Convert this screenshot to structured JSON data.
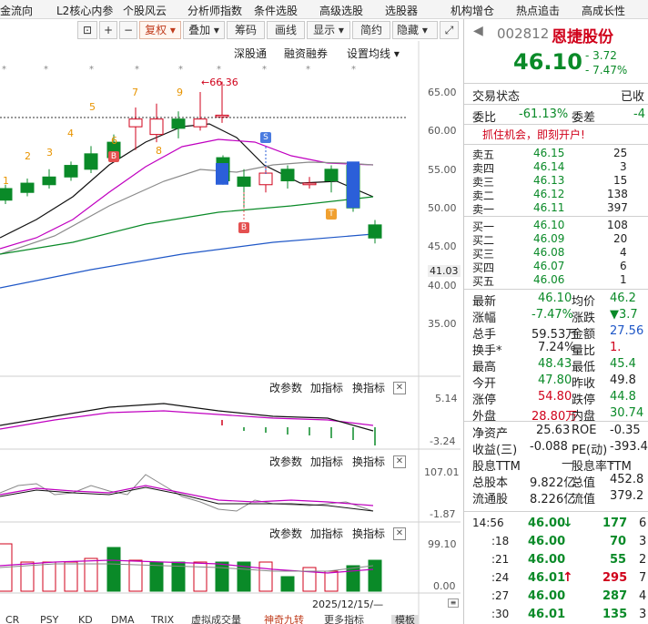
{
  "menu": [
    "金流向",
    "L2核心内参",
    "个股风云",
    "分析师指数",
    "条件选股",
    "高级选股",
    "选股器",
    "机构增仓",
    "热点追击",
    "高成长性"
  ],
  "toolbar": {
    "restore_label": "复权",
    "overlay_label": "叠加",
    "chip_label": "筹码",
    "draw_label": "画线",
    "display_label": "显示",
    "simple_label": "简约",
    "hide_label": "隐藏"
  },
  "sub_toolbar": {
    "shenguTong": "深股通",
    "margin": "融资融券",
    "set_ma": "设置均线"
  },
  "price_axis": [
    "65.00",
    "60.00",
    "55.00",
    "50.00",
    "45.00",
    "41.03",
    "40.00",
    "35.00"
  ],
  "annotations": {
    "high_price": "66.36",
    "counts": [
      "1",
      "2",
      "3",
      "4",
      "5",
      "6",
      "7",
      "8",
      "9"
    ],
    "B": "B",
    "S": "S",
    "T": "T"
  },
  "panels": [
    {
      "change": "改参数",
      "add": "加指标",
      "swap": "换指标",
      "top": "5.14",
      "bottom": "-3.24"
    },
    {
      "change": "改参数",
      "add": "加指标",
      "swap": "换指标",
      "top": "107.01",
      "bottom": "-1.87"
    },
    {
      "change": "改参数",
      "add": "加指标",
      "swap": "换指标",
      "top": "99.10",
      "bottom": "0.00"
    }
  ],
  "date_label": "2025/12/15/—",
  "bottom_tabs": [
    "CR",
    "PSY",
    "KD",
    "DMA",
    "TRIX",
    "虚拟成交量",
    "神奇九转",
    "更多指标",
    "模板"
  ],
  "quote": {
    "code": "002812",
    "name": "恩捷股份",
    "price": "46.10",
    "change": "- 3.72",
    "change_pct": "- 7.47%",
    "status_label": "交易状态",
    "status_value": "已收",
    "weibi_label": "委比",
    "weibi_value": "-61.13%",
    "weicha_label": "委差",
    "weicha_value": "-4",
    "promo": "抓住机会，即刻开户!"
  },
  "sells": [
    {
      "label": "卖五",
      "price": "46.15",
      "vol": "25"
    },
    {
      "label": "卖四",
      "price": "46.14",
      "vol": "3"
    },
    {
      "label": "卖三",
      "price": "46.13",
      "vol": "15"
    },
    {
      "label": "卖二",
      "price": "46.12",
      "vol": "138"
    },
    {
      "label": "卖一",
      "price": "46.11",
      "vol": "397"
    }
  ],
  "buys": [
    {
      "label": "买一",
      "price": "46.10",
      "vol": "108"
    },
    {
      "label": "买二",
      "price": "46.09",
      "vol": "20"
    },
    {
      "label": "买三",
      "price": "46.08",
      "vol": "4"
    },
    {
      "label": "买四",
      "price": "46.07",
      "vol": "6"
    },
    {
      "label": "买五",
      "price": "46.06",
      "vol": "1"
    }
  ],
  "stats": [
    {
      "l1": "最新",
      "v1": "46.10",
      "c1": "green",
      "l2": "均价",
      "v2": "46.2",
      "c2": "green"
    },
    {
      "l1": "涨幅",
      "v1": "-7.47%",
      "c1": "green",
      "l2": "涨跌",
      "v2": "▼3.7",
      "c2": "green"
    },
    {
      "l1": "总手",
      "v1": "59.53万",
      "c1": "",
      "l2": "金额",
      "v2": "27.56",
      "c2": "blue"
    },
    {
      "l1": "换手*",
      "v1": "7.24%",
      "c1": "",
      "l2": "量比",
      "v2": "1.",
      "c2": "red"
    },
    {
      "l1": "最高",
      "v1": "48.43",
      "c1": "green",
      "l2": "最低",
      "v2": "45.4",
      "c2": "green"
    },
    {
      "l1": "今开",
      "v1": "47.80",
      "c1": "green",
      "l2": "昨收",
      "v2": "49.8",
      "c2": ""
    },
    {
      "l1": "涨停",
      "v1": "54.80",
      "c1": "red",
      "l2": "跌停",
      "v2": "44.8",
      "c2": "green"
    },
    {
      "l1": "外盘",
      "v1": "28.80万",
      "c1": "red",
      "l2": "内盘",
      "v2": "30.74",
      "c2": "green"
    }
  ],
  "fundamentals": [
    {
      "l1": "净资产",
      "v1": "25.63",
      "l2": "ROE",
      "v2": "-0.35"
    },
    {
      "l1": "收益(三)",
      "v1": "-0.088",
      "l2": "PE(动)",
      "v2": "-393.4"
    },
    {
      "l1": "股息TTM",
      "v1": "—",
      "l2": "股息率TTM",
      "v2": "-"
    },
    {
      "l1": "总股本",
      "v1": "9.822亿",
      "l2": "总值",
      "v2": "452.8"
    },
    {
      "l1": "流通股",
      "v1": "8.226亿",
      "l2": "流值",
      "v2": "379.2"
    }
  ],
  "ticks": [
    {
      "time": "14:56",
      "price": "46.00",
      "arrow": "↓",
      "arrow_color": "green",
      "vol": "177",
      "vcolor": "green",
      "extra": "6"
    },
    {
      "time": ":18",
      "price": "46.00",
      "arrow": "",
      "arrow_color": "",
      "vol": "70",
      "vcolor": "green",
      "extra": "3"
    },
    {
      "time": ":21",
      "price": "46.00",
      "arrow": "",
      "arrow_color": "",
      "vol": "55",
      "vcolor": "green",
      "extra": "2"
    },
    {
      "time": ":24",
      "price": "46.01",
      "arrow": "↑",
      "arrow_color": "red",
      "vol": "295",
      "vcolor": "red",
      "extra": "7"
    },
    {
      "time": ":27",
      "price": "46.00",
      "arrow": "",
      "arrow_color": "",
      "vol": "287",
      "vcolor": "green",
      "extra": "4"
    },
    {
      "time": ":30",
      "price": "46.01",
      "arrow": "",
      "arrow_color": "",
      "vol": "135",
      "vcolor": "green",
      "extra": "3"
    }
  ],
  "colors": {
    "up": "#d0021b",
    "down": "#0a8a28",
    "ma5": "#111111",
    "ma10": "#c000c0",
    "ma20": "#0a8a28",
    "ma60": "#1f57c7"
  }
}
